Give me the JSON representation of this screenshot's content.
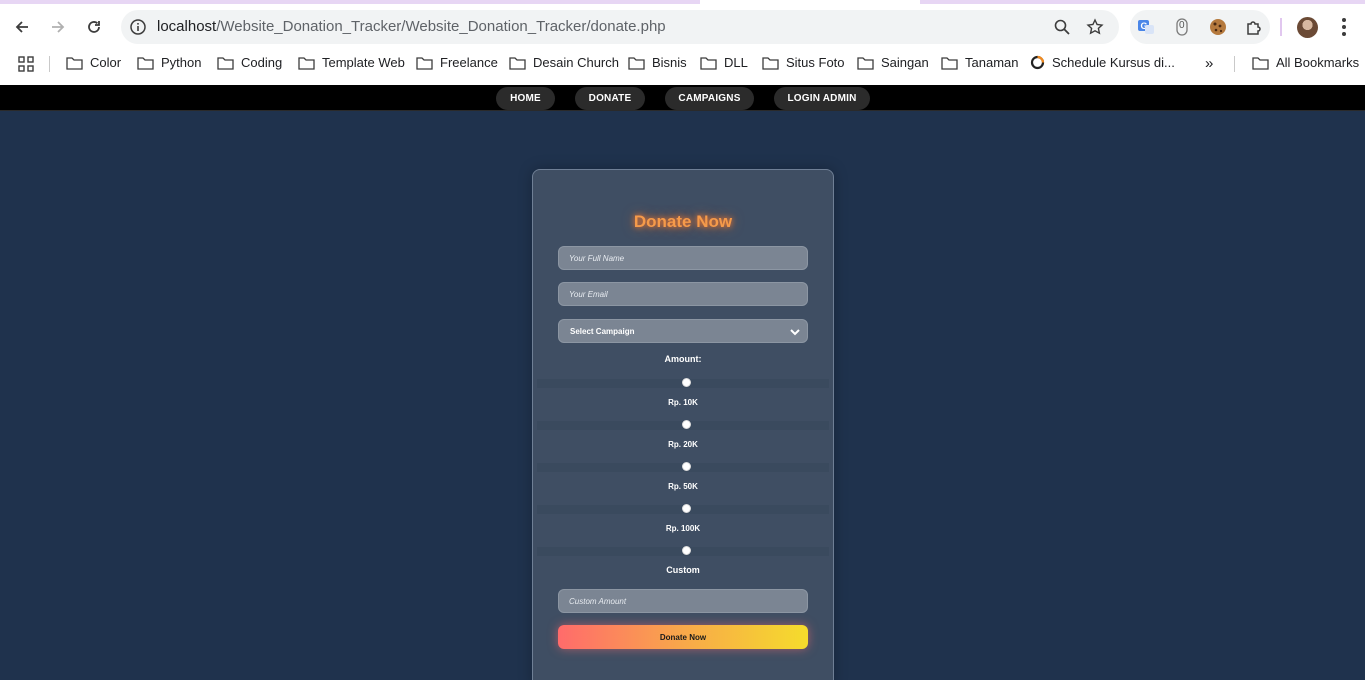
{
  "browser": {
    "url_host": "localhost",
    "url_path": "/Website_Donation_Tracker/Website_Donation_Tracker/donate.php",
    "extension_count": "0",
    "bookmarks": [
      {
        "label": "Color",
        "icon": "folder-icon"
      },
      {
        "label": "Python",
        "icon": "folder-icon"
      },
      {
        "label": "Coding",
        "icon": "folder-icon"
      },
      {
        "label": "Template Web",
        "icon": "folder-icon"
      },
      {
        "label": "Freelance",
        "icon": "folder-icon"
      },
      {
        "label": "Desain Church",
        "icon": "folder-icon"
      },
      {
        "label": "Bisnis",
        "icon": "folder-icon"
      },
      {
        "label": "DLL",
        "icon": "folder-icon"
      },
      {
        "label": "Situs Foto",
        "icon": "folder-icon"
      },
      {
        "label": "Saingan",
        "icon": "folder-icon"
      },
      {
        "label": "Tanaman",
        "icon": "folder-icon"
      },
      {
        "label": "Schedule Kursus di...",
        "icon": "site-icon"
      }
    ],
    "more_bookmarks": "»",
    "all_bookmarks": "All Bookmarks"
  },
  "nav": {
    "items": [
      "HOME",
      "DONATE",
      "CAMPAIGNS",
      "LOGIN ADMIN"
    ]
  },
  "form": {
    "title": "Donate Now",
    "name_placeholder": "Your Full Name",
    "email_placeholder": "Your Email",
    "campaign_selected": "Select Campaign",
    "amount_label": "Amount:",
    "amount_options": [
      "Rp. 10K",
      "Rp. 20K",
      "Rp. 50K",
      "Rp. 100K"
    ],
    "custom_label": "Custom",
    "custom_placeholder": "Custom Amount",
    "submit_label": "Donate Now"
  },
  "colors": {
    "page_bg": "#1f324d",
    "card_bg": "#3f4e63",
    "title_glow": "#f59a4a",
    "button_gradient_start": "#ff6b6b",
    "button_gradient_end": "#f5dc2c"
  }
}
